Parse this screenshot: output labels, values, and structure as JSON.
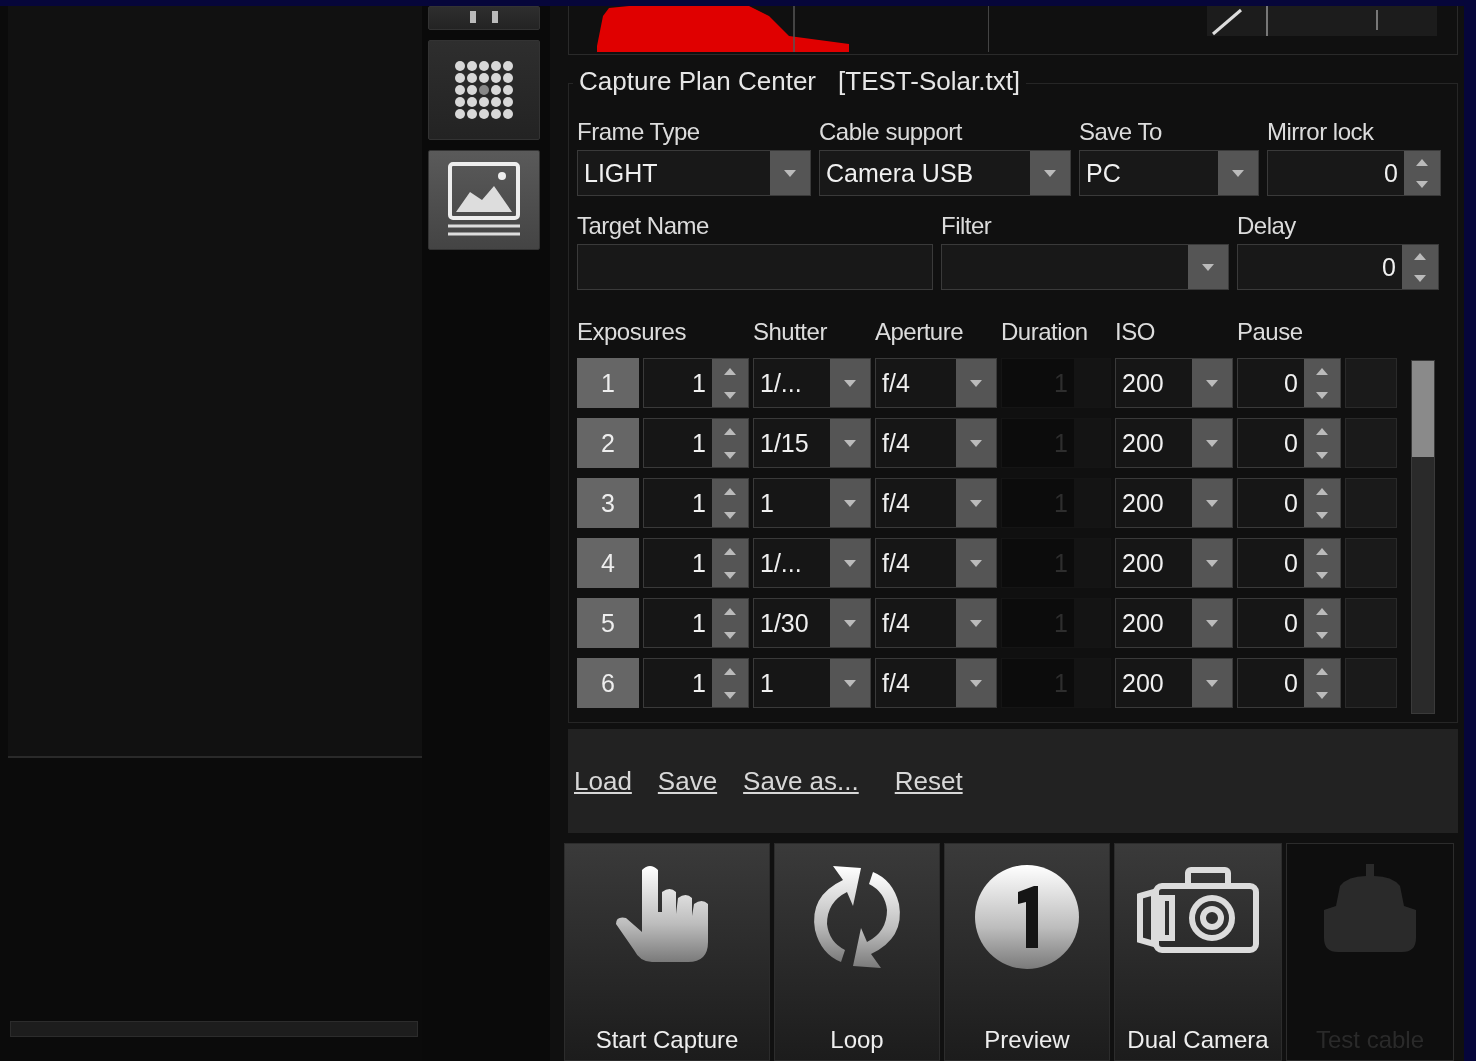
{
  "sidebar_tools": [
    {
      "kind": "partial",
      "selected": false
    },
    {
      "kind": "cube",
      "selected": false
    },
    {
      "kind": "image",
      "selected": true
    }
  ],
  "capture_plan": {
    "title": "Capture Plan Center",
    "file": "[TEST-Solar.txt]",
    "fields": [
      {
        "label": "Frame Type",
        "kind": "combo",
        "value": "LIGHT"
      },
      {
        "label": "Cable support",
        "kind": "combo",
        "value": "Camera USB"
      },
      {
        "label": "Save To",
        "kind": "combo",
        "value": "PC"
      },
      {
        "label": "Mirror lock",
        "kind": "spin",
        "value": "0"
      }
    ],
    "fields_2": [
      {
        "label": "Target Name",
        "kind": "text"
      },
      {
        "label": "Filter",
        "kind": "combo"
      },
      {
        "label": "Delay",
        "kind": "spin",
        "value": "0"
      }
    ],
    "columns": [
      "Exposures",
      "Shutter",
      "Aperture",
      "Duration",
      "ISO",
      "Pause"
    ],
    "rows": [
      {
        "index": "1",
        "exposures": "1",
        "shutter": "1/...",
        "aperture": "f/4",
        "duration": "1",
        "duration_disabled": true,
        "iso": "200",
        "pause": "0"
      },
      {
        "index": "2",
        "exposures": "1",
        "shutter": "1/15",
        "aperture": "f/4",
        "duration": "1",
        "duration_disabled": true,
        "iso": "200",
        "pause": "0"
      },
      {
        "index": "3",
        "exposures": "1",
        "shutter": "1",
        "aperture": "f/4",
        "duration": "1",
        "duration_disabled": true,
        "iso": "200",
        "pause": "0"
      },
      {
        "index": "4",
        "exposures": "1",
        "shutter": "1/...",
        "aperture": "f/4",
        "duration": "1",
        "duration_disabled": true,
        "iso": "200",
        "pause": "0"
      },
      {
        "index": "5",
        "exposures": "1",
        "shutter": "1/30",
        "aperture": "f/4",
        "duration": "1",
        "duration_disabled": true,
        "iso": "200",
        "pause": "0"
      },
      {
        "index": "6",
        "exposures": "1",
        "shutter": "1",
        "aperture": "f/4",
        "duration": "1",
        "duration_disabled": true,
        "iso": "200",
        "pause": "0"
      }
    ],
    "links": [
      "Load",
      "Save",
      "Save as...",
      "Reset"
    ]
  },
  "actions": [
    {
      "label": "Start Capture",
      "kind": "hand",
      "disabled": false
    },
    {
      "label": "Loop",
      "kind": "loop",
      "disabled": false
    },
    {
      "label": "Preview",
      "kind": "one",
      "disabled": false
    },
    {
      "label": "Dual Camera",
      "kind": "camera",
      "disabled": false
    },
    {
      "label": "Test cable",
      "kind": "cable",
      "disabled": true
    }
  ]
}
